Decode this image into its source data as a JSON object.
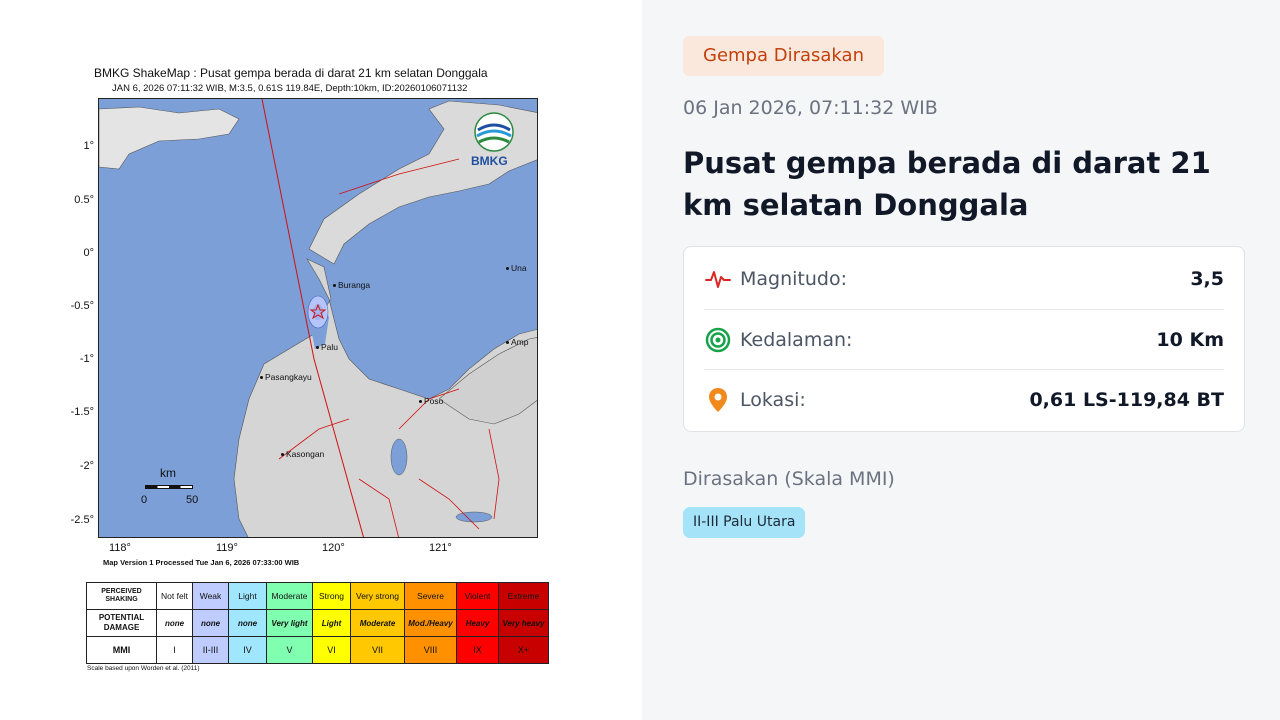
{
  "shakemap": {
    "title": "BMKG ShakeMap : Pusat gempa berada di darat 21 km selatan Donggala",
    "subtitle": "JAN 6, 2026 07:11:32 WIB, M:3.5, 0.61S 119.84E, Depth:10km, ID:20260106071132",
    "logo_text": "BMKG",
    "lat_ticks": [
      "1°",
      "0.5°",
      "0°",
      "-0.5°",
      "-1°",
      "-1.5°",
      "-2°",
      "-2.5°"
    ],
    "lon_ticks": [
      "118°",
      "119°",
      "120°",
      "121°"
    ],
    "cities": [
      "Buranga",
      "Palu",
      "Pasangkayu",
      "Kasongan",
      "Poso",
      "Una",
      "Amp"
    ],
    "scale_unit": "km",
    "scale_start": "0",
    "scale_end": "50",
    "map_version": "Map Version 1 Processed Tue Jan  6, 2026 07:33:00 WIB",
    "legend": {
      "row_headers": [
        "PERCEIVED SHAKING",
        "POTENTIAL DAMAGE",
        "MMI"
      ],
      "shaking": [
        "Not felt",
        "Weak",
        "Light",
        "Moderate",
        "Strong",
        "Very strong",
        "Severe",
        "Violent",
        "Extreme"
      ],
      "damage": [
        "none",
        "none",
        "none",
        "Very light",
        "Light",
        "Moderate",
        "Mod./Heavy",
        "Heavy",
        "Very heavy"
      ],
      "mmi": [
        "I",
        "II-III",
        "IV",
        "V",
        "VI",
        "VII",
        "VIII",
        "IX",
        "X+"
      ],
      "colors": [
        "#ffffff",
        "#bfccff",
        "#a0e6ff",
        "#80ffb0",
        "#ffff00",
        "#ffc800",
        "#ff9100",
        "#ff0000",
        "#c80000"
      ]
    },
    "scale_note": "Scale based upon Worden et al. (2011)"
  },
  "info": {
    "badge": "Gempa Dirasakan",
    "datetime": "06 Jan 2026, 07:11:32 WIB",
    "headline": "Pusat gempa berada di darat 21 km selatan Donggala",
    "magnitude_label": "Magnitudo:",
    "magnitude_value": "3,5",
    "depth_label": "Kedalaman:",
    "depth_value": "10 Km",
    "location_label": "Lokasi:",
    "location_value": "0,61 LS-119,84 BT",
    "felt_title": "Dirasakan (Skala MMI)",
    "felt_chip": "II-III Palu Utara",
    "colors": {
      "badge_text": "#c2410c",
      "badge_bg": "#fbe8dc",
      "chip_bg": "#a5e4f8",
      "magnitude_icon": "#dc2626",
      "depth_icon": "#16a34a",
      "location_icon": "#f08a1c"
    }
  }
}
